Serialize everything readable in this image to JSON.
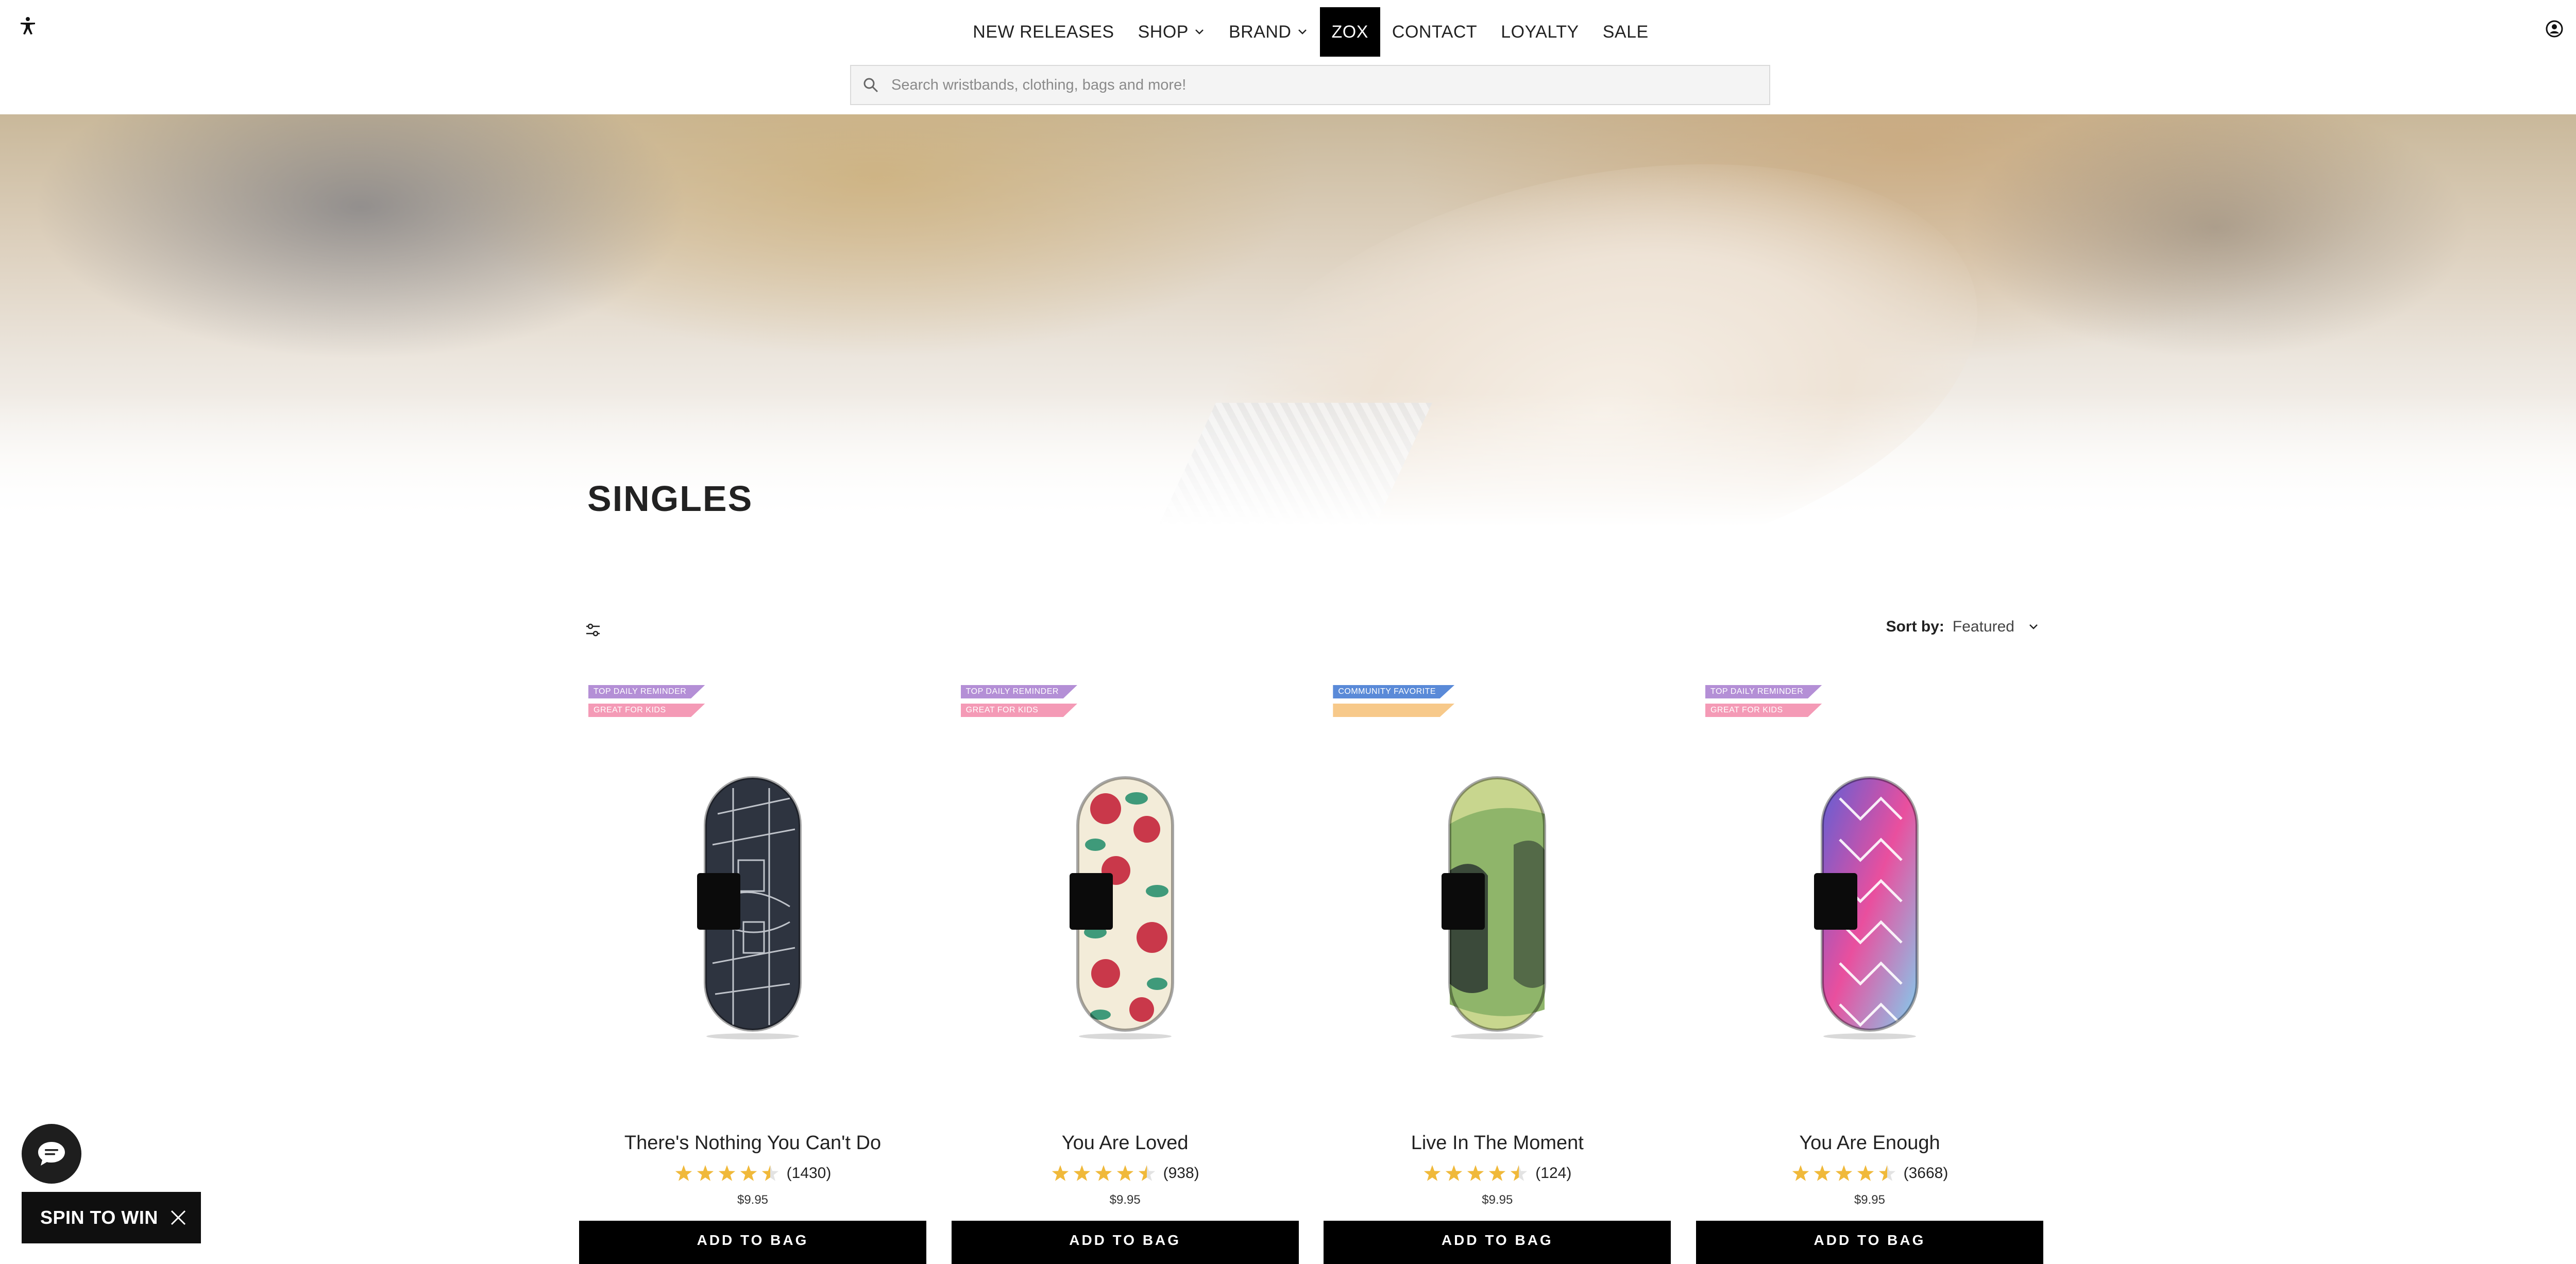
{
  "nav": {
    "items": [
      {
        "label": "NEW RELEASES",
        "dropdown": false,
        "active": false
      },
      {
        "label": "SHOP",
        "dropdown": true,
        "active": false
      },
      {
        "label": "BRAND",
        "dropdown": true,
        "active": false
      },
      {
        "label": "ZOX",
        "dropdown": false,
        "active": true
      },
      {
        "label": "CONTACT",
        "dropdown": false,
        "active": false
      },
      {
        "label": "LOYALTY",
        "dropdown": false,
        "active": false
      },
      {
        "label": "SALE",
        "dropdown": false,
        "active": false
      }
    ]
  },
  "header": {
    "icons": [
      "accessibility-icon",
      "account-icon",
      "bag-icon"
    ],
    "bag_count": "0"
  },
  "search": {
    "placeholder": "Search wristbands, clothing, bags and more!"
  },
  "page": {
    "title": "SINGLES"
  },
  "sort": {
    "label": "Sort by:",
    "value": "Featured"
  },
  "products": [
    {
      "name": "There's Nothing You Can't Do",
      "rating": 4.5,
      "reviews": "(1430)",
      "price": "$9.95",
      "button": "ADD TO BAG",
      "badges": [
        {
          "text": "TOP DAILY REMINDER",
          "color": "#b48fd6"
        },
        {
          "text": "GREAT FOR KIDS",
          "color": "#f49ab6"
        }
      ],
      "colors": [
        "#2e3440",
        "#d9dde3"
      ]
    },
    {
      "name": "You Are Loved",
      "rating": 4.5,
      "reviews": "(938)",
      "price": "$9.95",
      "button": "ADD TO BAG",
      "badges": [
        {
          "text": "TOP DAILY REMINDER",
          "color": "#b48fd6"
        },
        {
          "text": "GREAT FOR KIDS",
          "color": "#f49ab6"
        }
      ],
      "colors": [
        "#f3ecd9",
        "#c9384a",
        "#3f9a7a"
      ]
    },
    {
      "name": "Live In The Moment",
      "rating": 4.5,
      "reviews": "(124)",
      "price": "$9.95",
      "button": "ADD TO BAG",
      "badges": [
        {
          "text": "COMMUNITY FAVORITE",
          "color": "#5a8ad8"
        },
        {
          "text": "",
          "color": "#f7c98a"
        }
      ],
      "colors": [
        "#3b4a3a",
        "#8fb56a",
        "#c8d68e"
      ]
    },
    {
      "name": "You Are Enough",
      "rating": 4.5,
      "reviews": "(3668)",
      "price": "$9.95",
      "button": "ADD TO BAG",
      "badges": [
        {
          "text": "TOP DAILY REMINDER",
          "color": "#b48fd6"
        },
        {
          "text": "GREAT FOR KIDS",
          "color": "#f49ab6"
        }
      ],
      "colors": [
        "#e94f9e",
        "#5f5fd6",
        "#7fd0f0"
      ]
    }
  ],
  "widgets": {
    "chat_icon": "chat-icon",
    "spin_label": "SPIN TO WIN"
  },
  "colors": {
    "star": "#f0b93a",
    "button_bg": "#000000",
    "active_nav_bg": "#000000"
  }
}
